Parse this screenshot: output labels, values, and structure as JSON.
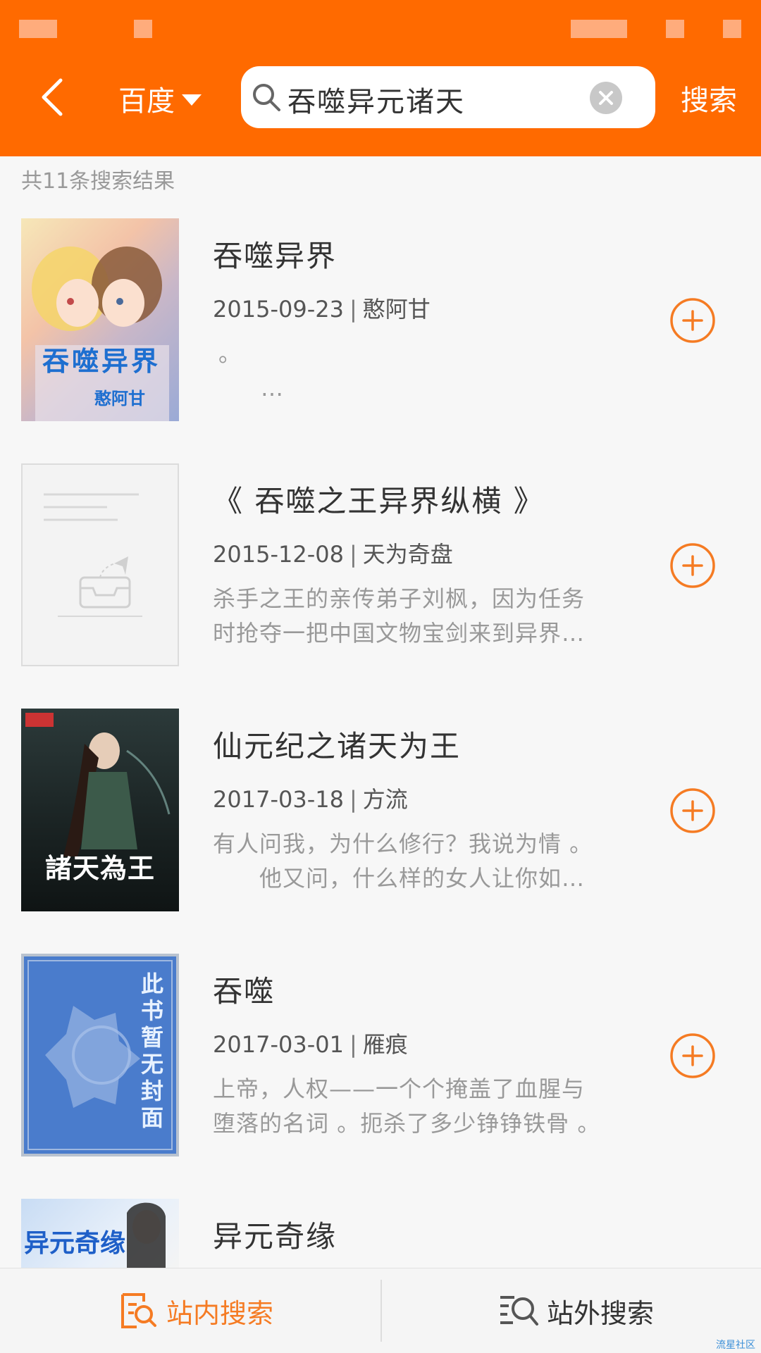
{
  "header": {
    "back_icon": "chevron-left-icon",
    "search_engine": "百度",
    "search_value": "吞噬异元诸天",
    "search_button": "搜索",
    "accent_color": "#ff6a00"
  },
  "result_count": "共11条搜索结果",
  "results": [
    {
      "title": "吞噬异界",
      "date": "2015-09-23",
      "author": "憨阿甘",
      "desc1": "。",
      "desc2": "…",
      "cover_text": "吞噬异界",
      "cover_author": "憨阿甘"
    },
    {
      "title": "《 吞噬之王异界纵横 》",
      "date": "2015-12-08",
      "author": "天为奇盘",
      "desc1": "杀手之王的亲传弟子刘枫，因为任务",
      "desc2": "时抢夺一把中国文物宝剑来到异界…"
    },
    {
      "title": "仙元纪之诸天为王",
      "date": "2017-03-18",
      "author": "方流",
      "desc1": "有人问我，为什么修行？我说为情 。",
      "desc2": "　　他又问，什么样的女人让你如…",
      "cover_text": "諸天為王"
    },
    {
      "title": "吞噬",
      "date": "2017-03-01",
      "author": "雁痕",
      "desc1": "上帝，人权——一个个掩盖了血腥与",
      "desc2": "堕落的名词 。扼杀了多少铮铮铁骨 。",
      "cover_text": "此书暂无封面"
    },
    {
      "title": "异元奇缘",
      "cover_text": "异元奇缘"
    }
  ],
  "bottom_tabs": {
    "internal": "站内搜索",
    "external": "站外搜索"
  },
  "watermark": "流星社区"
}
